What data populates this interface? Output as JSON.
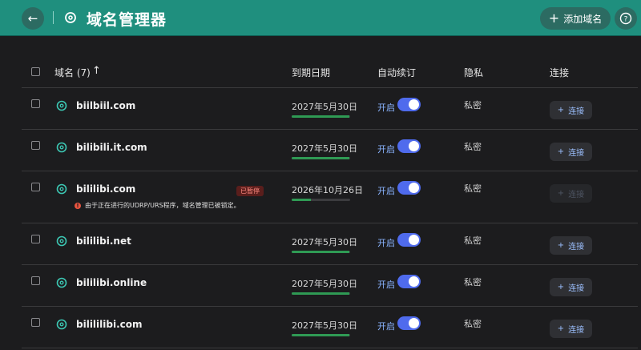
{
  "header": {
    "title": "域名管理器",
    "add_label": "添加域名",
    "accent": "#1f8f7e"
  },
  "columns": {
    "domain": "域名 (7)",
    "sort_arrow": "↑",
    "expiry": "到期日期",
    "auto_renew": "自动续订",
    "privacy": "隐私",
    "connect": "连接"
  },
  "rows": [
    {
      "domain": "biilbiil.com",
      "expiry": "2027年5月30日",
      "renew_label": "开启",
      "privacy": "私密",
      "connect_label": "连接",
      "progress": 0.98
    },
    {
      "domain": "bilibili.it.com",
      "expiry": "2027年5月30日",
      "renew_label": "开启",
      "privacy": "私密",
      "connect_label": "连接",
      "progress": 0.98
    },
    {
      "domain": "bililibi.com",
      "expiry": "2026年10月26日",
      "renew_label": "开启",
      "privacy": "私密",
      "connect_label": "连接",
      "progress": 0.33,
      "badge": "已暂停",
      "warning": "由于正在进行的UDRP/URS程序，域名管理已被锁定。"
    },
    {
      "domain": "bililibi.net",
      "expiry": "2027年5月30日",
      "renew_label": "开启",
      "privacy": "私密",
      "connect_label": "连接",
      "progress": 0.98
    },
    {
      "domain": "bililibi.online",
      "expiry": "2027年5月30日",
      "renew_label": "开启",
      "privacy": "私密",
      "connect_label": "连接",
      "progress": 0.98
    },
    {
      "domain": "bilililibi.com",
      "expiry": "2027年5月30日",
      "renew_label": "开启",
      "privacy": "私密",
      "connect_label": "连接",
      "progress": 0.98
    }
  ],
  "icons": {
    "back": "arrow-left-icon",
    "title": "domain-target-icon",
    "add": "plus-icon",
    "help": "help-icon"
  }
}
